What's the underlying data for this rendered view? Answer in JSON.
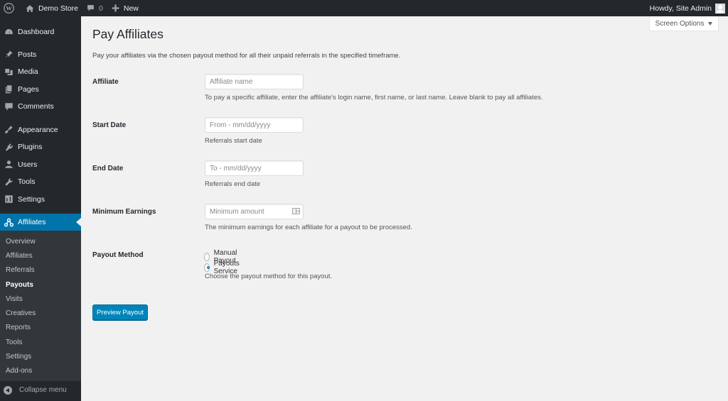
{
  "adminbar": {
    "site_name": "Demo Store",
    "comments_count": "0",
    "new_label": "New",
    "greeting": "Howdy, Site Admin"
  },
  "sidebar": {
    "items": [
      {
        "label": "Dashboard",
        "icon": "dashboard-icon"
      },
      {
        "label": "Posts",
        "icon": "pin-icon"
      },
      {
        "label": "Media",
        "icon": "media-icon"
      },
      {
        "label": "Pages",
        "icon": "pages-icon"
      },
      {
        "label": "Comments",
        "icon": "comment-icon"
      },
      {
        "label": "Appearance",
        "icon": "brush-icon"
      },
      {
        "label": "Plugins",
        "icon": "plug-icon"
      },
      {
        "label": "Users",
        "icon": "user-icon"
      },
      {
        "label": "Tools",
        "icon": "wrench-icon"
      },
      {
        "label": "Settings",
        "icon": "settings-icon"
      },
      {
        "label": "Affiliates",
        "icon": "affiliates-icon",
        "active": true
      }
    ],
    "submenu": [
      {
        "label": "Overview"
      },
      {
        "label": "Affiliates"
      },
      {
        "label": "Referrals"
      },
      {
        "label": "Payouts",
        "current": true
      },
      {
        "label": "Visits"
      },
      {
        "label": "Creatives"
      },
      {
        "label": "Reports"
      },
      {
        "label": "Tools"
      },
      {
        "label": "Settings"
      },
      {
        "label": "Add-ons"
      }
    ],
    "collapse_label": "Collapse menu"
  },
  "screen_options": {
    "label": "Screen Options"
  },
  "page": {
    "title": "Pay Affiliates",
    "description": "Pay your affiliates via the chosen payout method for all their unpaid referrals in the specified timeframe."
  },
  "form": {
    "affiliate": {
      "label": "Affiliate",
      "value": "",
      "placeholder": "Affiliate name",
      "help": "To pay a specific affiliate, enter the affiliate's login name, first name, or last name. Leave blank to pay all affiliates."
    },
    "start_date": {
      "label": "Start Date",
      "value": "",
      "placeholder": "From - mm/dd/yyyy",
      "help": "Referrals start date"
    },
    "end_date": {
      "label": "End Date",
      "value": "",
      "placeholder": "To - mm/dd/yyyy",
      "help": "Referrals end date"
    },
    "minimum_earnings": {
      "label": "Minimum Earnings",
      "value": "",
      "placeholder": "Minimum amount",
      "help": "The minimum earnings for each affiliate for a payout to be processed."
    },
    "payout_method": {
      "label": "Payout Method",
      "options": [
        {
          "label": "Manual Payout",
          "checked": false
        },
        {
          "label": "Payouts Service",
          "checked": true
        }
      ],
      "help": "Choose the payout method for this payout."
    },
    "submit_label": "Preview Payout"
  },
  "colors": {
    "admin_bar": "#23282d",
    "accent": "#0073aa",
    "button": "#0085ba",
    "background": "#f1f1f1"
  }
}
